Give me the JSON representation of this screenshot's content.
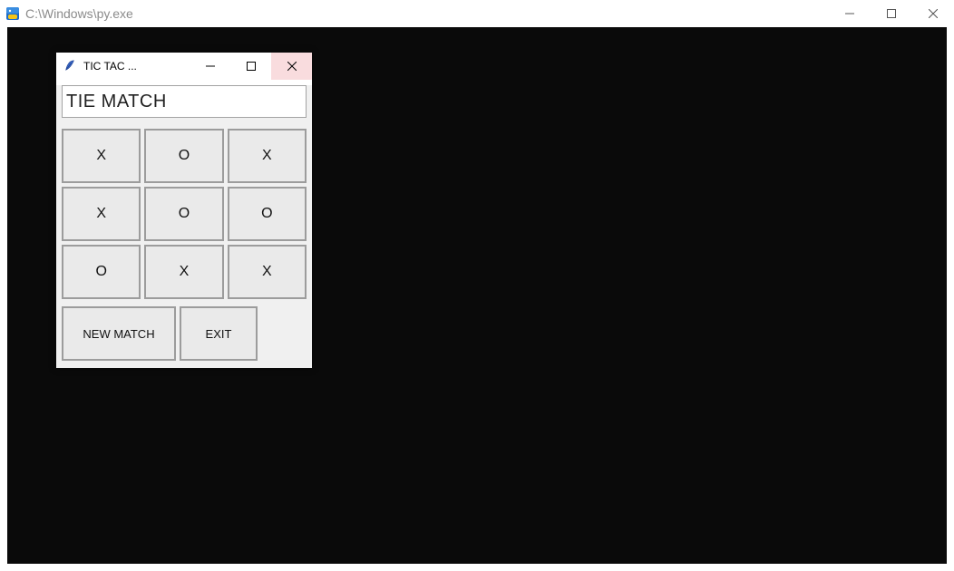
{
  "outer": {
    "title": "C:\\Windows\\py.exe"
  },
  "tk": {
    "title": "TIC TAC ...",
    "status": "TIE MATCH",
    "grid": [
      "X",
      "O",
      "X",
      "X",
      "O",
      "O",
      "O",
      "X",
      "X"
    ],
    "buttons": {
      "new_match": "NEW MATCH",
      "exit": "EXIT"
    }
  }
}
